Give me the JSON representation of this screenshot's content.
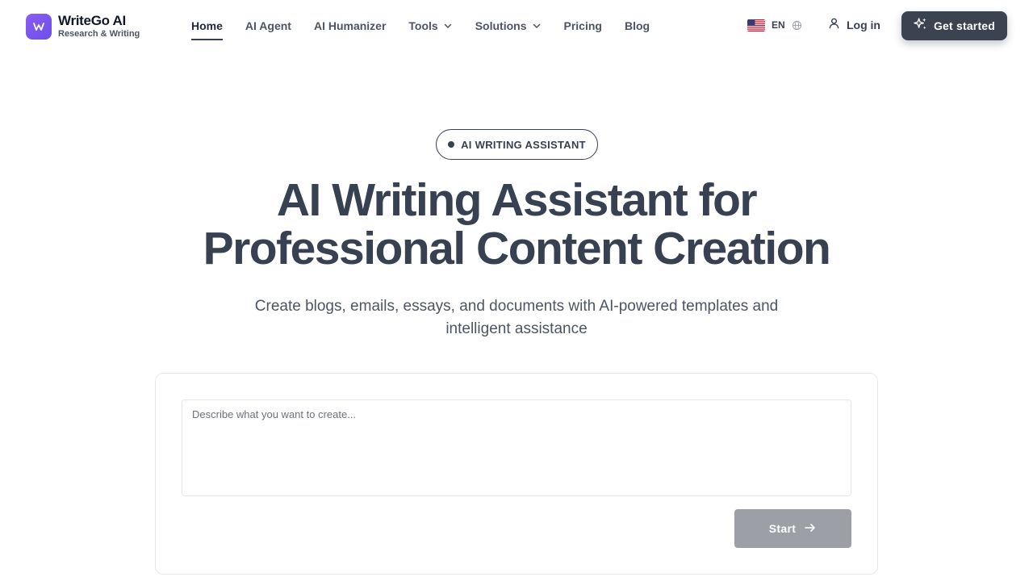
{
  "brand": {
    "name": "WriteGo AI",
    "tagline": "Research & Writing",
    "logo_glyph": "w-icon",
    "accent": "#7c5cf0"
  },
  "nav": {
    "items": [
      {
        "label": "Home",
        "active": true
      },
      {
        "label": "AI Agent"
      },
      {
        "label": "AI Humanizer"
      },
      {
        "label": "Tools",
        "dropdown": true
      },
      {
        "label": "Solutions",
        "dropdown": true
      },
      {
        "label": "Pricing"
      },
      {
        "label": "Blog"
      }
    ]
  },
  "header": {
    "language_code": "EN",
    "login_label": "Log in",
    "cta_label": "Get started"
  },
  "hero": {
    "badge": "AI WRITING ASSISTANT",
    "title_line1": "AI Writing Assistant for",
    "title_line2": "Professional Content Creation",
    "subtitle": "Create blogs, emails, essays, and documents with AI-powered templates and intelligent assistance"
  },
  "composer": {
    "placeholder": "Describe what you want to create...",
    "value": "",
    "start_label": "Start"
  },
  "colors": {
    "primary_dark": "#3b4350",
    "text": "#374151",
    "muted_button": "#9ca0a6",
    "border": "#e5e7eb"
  }
}
